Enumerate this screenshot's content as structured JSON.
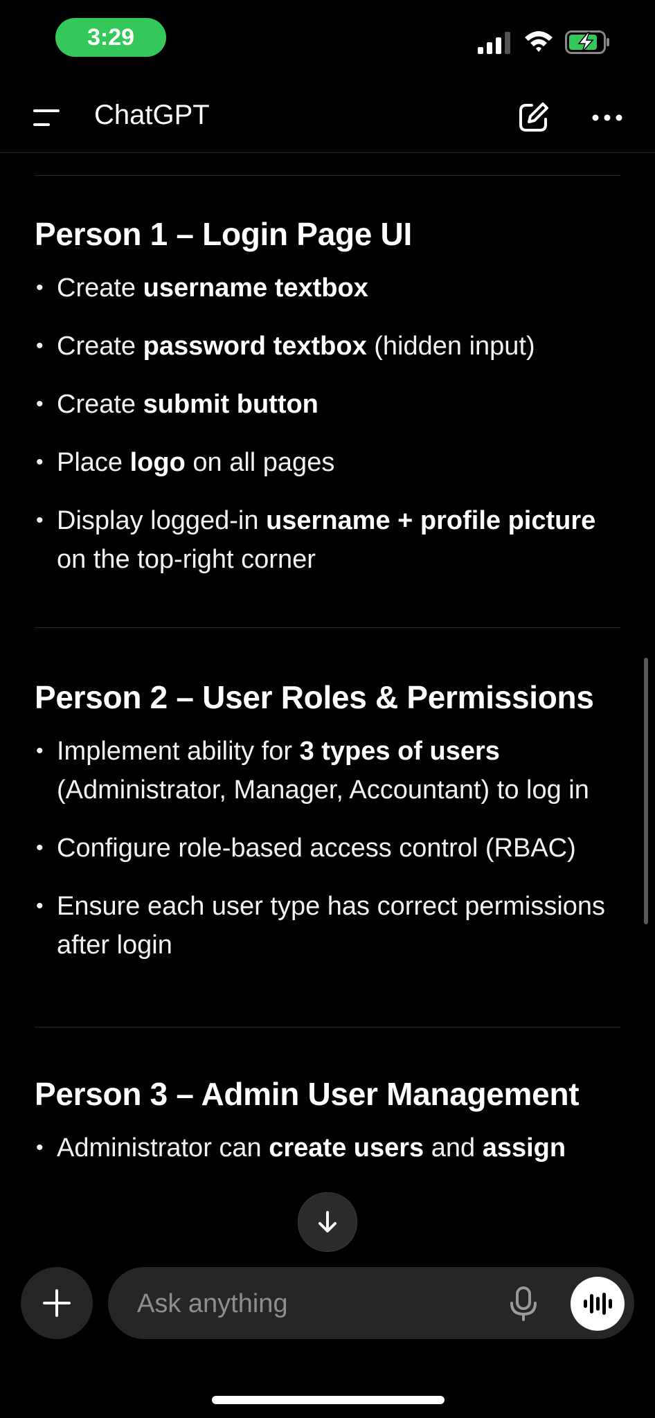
{
  "status_bar": {
    "time": "3:29"
  },
  "header": {
    "title": "ChatGPT"
  },
  "sections": [
    {
      "title": "Person 1 – Login Page UI",
      "items": [
        [
          {
            "t": "Create "
          },
          {
            "t": "username textbox",
            "b": true
          }
        ],
        [
          {
            "t": "Create "
          },
          {
            "t": "password textbox",
            "b": true
          },
          {
            "t": " (hidden input)"
          }
        ],
        [
          {
            "t": "Create "
          },
          {
            "t": "submit button",
            "b": true
          }
        ],
        [
          {
            "t": "Place "
          },
          {
            "t": "logo",
            "b": true
          },
          {
            "t": " on all pages"
          }
        ],
        [
          {
            "t": "Display logged-in "
          },
          {
            "t": "username + profile picture",
            "b": true
          },
          {
            "t": " on the top-right corner"
          }
        ]
      ]
    },
    {
      "title": "Person 2 – User Roles & Permissions",
      "items": [
        [
          {
            "t": "Implement ability for "
          },
          {
            "t": "3 types of users",
            "b": true
          },
          {
            "t": " (Administrator, Manager, Accountant) to log in"
          }
        ],
        [
          {
            "t": "Configure role-based access control (RBAC)"
          }
        ],
        [
          {
            "t": "Ensure each user type has correct permissions after login"
          }
        ]
      ]
    },
    {
      "title": "Person 3 – Admin User Management",
      "items": [
        [
          {
            "t": "Administrator can "
          },
          {
            "t": "create users",
            "b": true
          },
          {
            "t": " and "
          },
          {
            "t": "assign",
            "b": true
          }
        ]
      ]
    }
  ],
  "composer": {
    "placeholder": "Ask anything"
  },
  "icons": {
    "menu": "menu-icon",
    "edit": "compose-icon",
    "more": "more-icon",
    "plus": "plus-icon",
    "mic": "microphone-icon",
    "voice": "voice-mode-icon",
    "scroll_down": "arrow-down-icon"
  },
  "colors": {
    "time_pill": "#34c759",
    "background": "#000000",
    "composer": "#262626"
  }
}
